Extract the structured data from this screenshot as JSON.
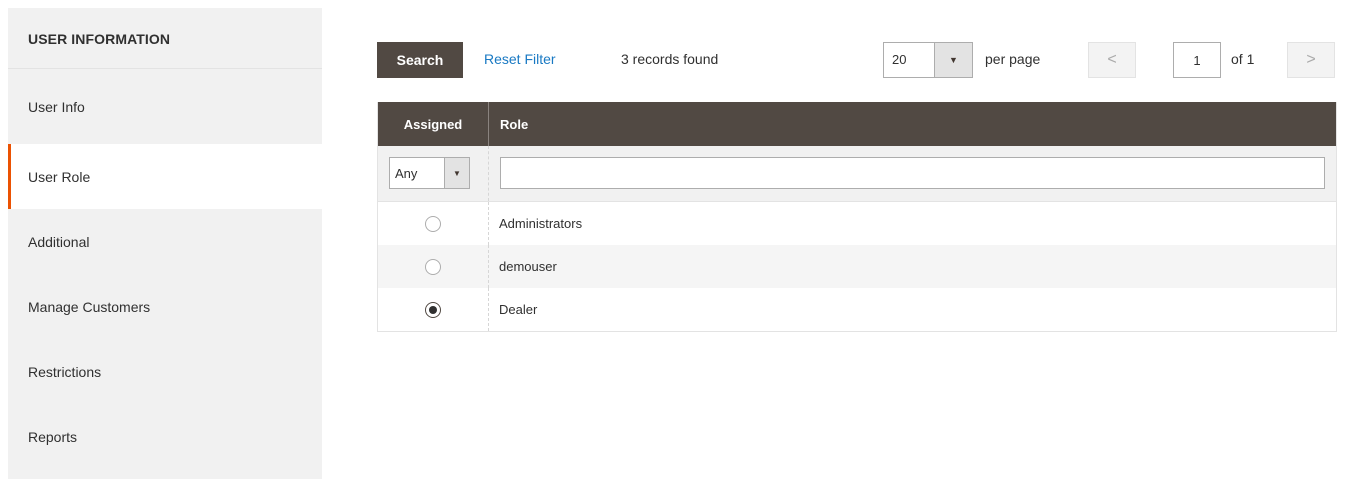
{
  "sidebar": {
    "title": "USER INFORMATION",
    "items": [
      {
        "label": "User Info"
      },
      {
        "label": "User Role"
      },
      {
        "label": "Additional"
      },
      {
        "label": "Manage Customers"
      },
      {
        "label": "Restrictions"
      },
      {
        "label": "Reports"
      }
    ],
    "active_item": "User Role",
    "accent_color": "#eb5202"
  },
  "toolbar": {
    "search_label": "Search",
    "reset_filter_label": "Reset Filter",
    "records_found": "3 records found",
    "per_page_value": "20",
    "per_page_label": "per page",
    "prev_icon": "<",
    "next_icon": ">",
    "current_page": "1",
    "total_pages_text": "of 1"
  },
  "grid": {
    "columns": {
      "assigned": "Assigned",
      "role": "Role"
    },
    "filter": {
      "assigned_value": "Any",
      "role_value": ""
    },
    "rows": [
      {
        "role": "Administrators",
        "assigned": false
      },
      {
        "role": "demouser",
        "assigned": false
      },
      {
        "role": "Dealer",
        "assigned": true
      }
    ],
    "header_color": "#514943"
  }
}
